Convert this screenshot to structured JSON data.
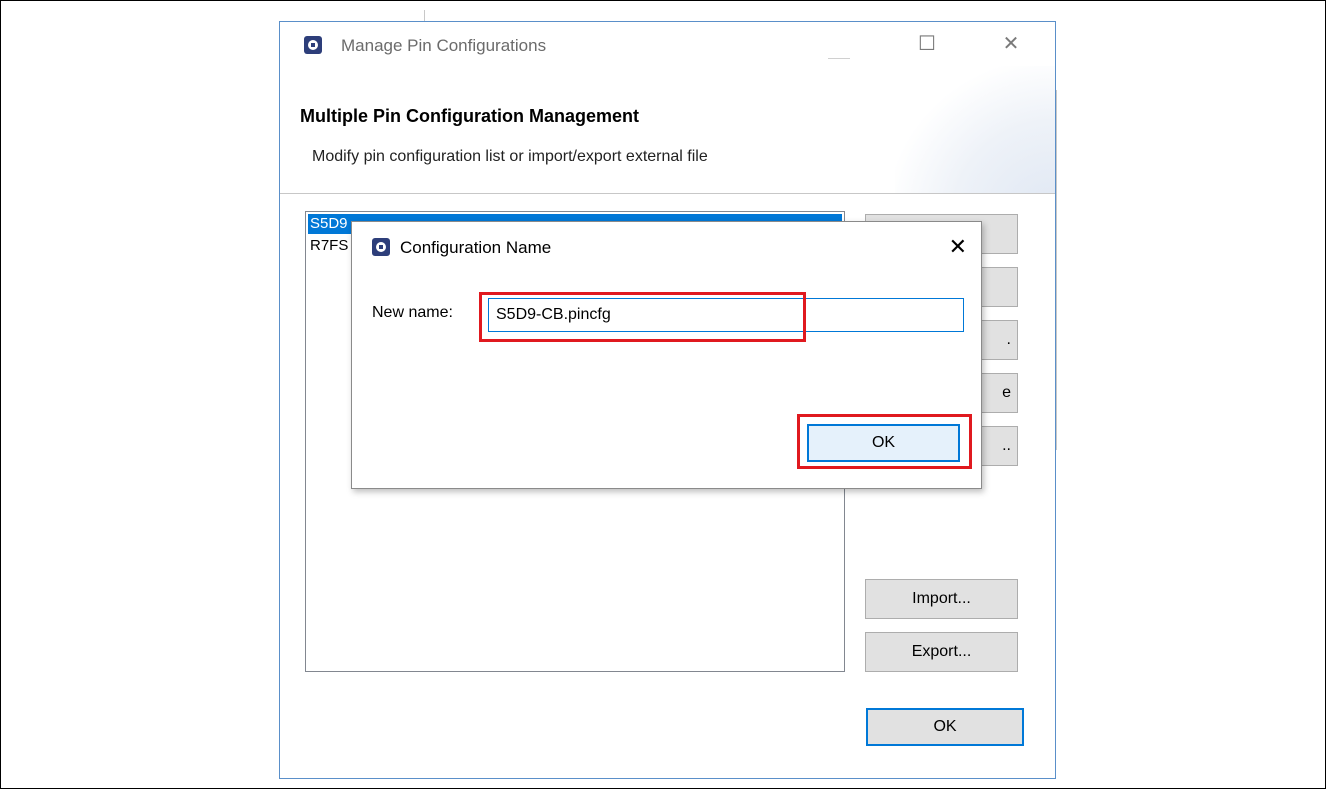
{
  "main_dialog": {
    "title": "Manage Pin Configurations",
    "close_glyph": "✕",
    "maximize_glyph": "☐",
    "banner_title": "Multiple Pin Configuration Management",
    "banner_subtitle": "Modify pin configuration list or import/export external file",
    "list_items": [
      {
        "label": "S5D9",
        "selected": true
      },
      {
        "label": "R7FS",
        "selected": false
      }
    ],
    "side_buttons": [
      "",
      "",
      ".",
      "e",
      "..",
      "Import...",
      "Export..."
    ],
    "ok_label": "OK"
  },
  "sub_dialog": {
    "title": "Configuration Name",
    "close_glyph": "✕",
    "name_label": "New name:",
    "name_value": "S5D9-CB.pincfg",
    "ok_label": "OK"
  },
  "highlight_color": "#e0191f",
  "accent_color": "#0078d7"
}
